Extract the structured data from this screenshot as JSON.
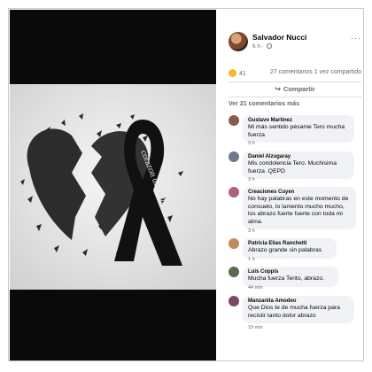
{
  "image": {
    "ribbon_text": "corazon destrozado"
  },
  "post": {
    "author": "Salvador Nucci",
    "time": "6 h",
    "more": "···",
    "reaction_count": "41",
    "comment_count": "27 comentarios",
    "share_count": "1 vez compartido",
    "share_label": "Compartir",
    "view_more": "Ver 21 comentarios más"
  },
  "comments": [
    {
      "name": "Gustavo Martinez",
      "text": "Mi más sentido pésame Tero mucha fuerza",
      "time": "3 h"
    },
    {
      "name": "Daniel Alzugaray",
      "text": "Mis condolencia Tero. Muchisima fuerza .QEPD",
      "time": "3 h"
    },
    {
      "name": "Creaciones Cuyen",
      "text": "No hay palabras en este momento de consuelo, lo lamento mucho mucho, los abrazo fuerte fuerte con toda mi alma.",
      "time": "3 h"
    },
    {
      "name": "Patricia Elias Ranchetti",
      "text": "Abrazo grande sin palabras",
      "time": "1 h"
    },
    {
      "name": "Luis Coppis",
      "text": "Mucha fuerza Terito, abrazo.",
      "time": "44 min"
    },
    {
      "name": "Manzanita Amodeo",
      "text": "Que Dios te de mucha fuerza para recistir tanto dolor abrazo",
      "time": "19 min"
    }
  ],
  "colors": {
    "photo_bg": "#0a0a0a",
    "heart": "#2c2c2c",
    "ribbon": "#111111",
    "bubble": "#f0f2f5",
    "muted": "#65676b"
  }
}
